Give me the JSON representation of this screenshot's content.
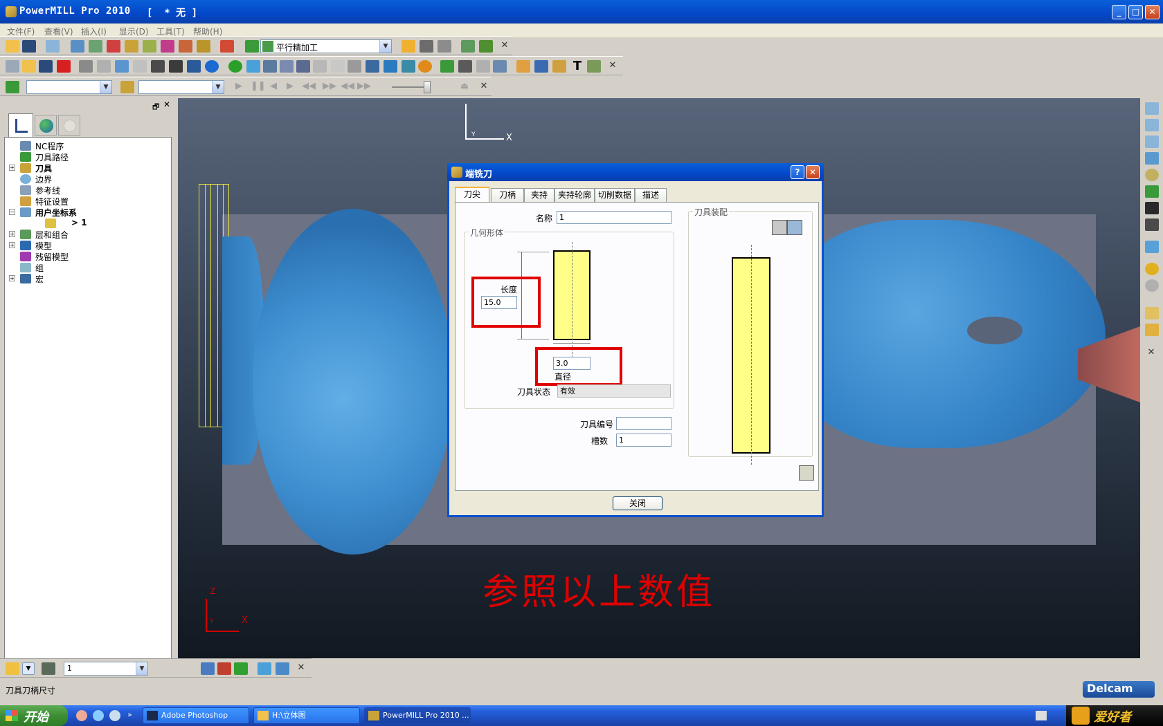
{
  "window": {
    "app_title": "PowerMILL Pro 2010",
    "doc_title": "[  * 无 ]",
    "min_label": "_",
    "max_label": "□",
    "close_label": "✕"
  },
  "menu": [
    "文件(F)",
    "查看(V)",
    "插入(I)",
    "显示(D)",
    "工具(T)",
    "帮助(H)"
  ],
  "toolbar1": {
    "strategy_combo": "平行精加工"
  },
  "toolbar3": {
    "combo1": "",
    "combo2": ""
  },
  "tree": {
    "items": [
      {
        "label": "NC程序",
        "bold": false,
        "expand": false
      },
      {
        "label": "刀具路径",
        "bold": false,
        "expand": false
      },
      {
        "label": "刀具",
        "bold": true,
        "expand": true
      },
      {
        "label": "边界",
        "bold": false,
        "expand": false
      },
      {
        "label": "参考线",
        "bold": false,
        "expand": false
      },
      {
        "label": "特征设置",
        "bold": false,
        "expand": false
      },
      {
        "label": "用户坐标系",
        "bold": true,
        "expand": true
      },
      {
        "label": "> 1",
        "bold": false,
        "expand": false
      },
      {
        "label": "层和组合",
        "bold": false,
        "expand": true
      },
      {
        "label": "模型",
        "bold": false,
        "expand": true
      },
      {
        "label": "残留模型",
        "bold": false,
        "expand": false
      },
      {
        "label": "组",
        "bold": false,
        "expand": false
      },
      {
        "label": "宏",
        "bold": false,
        "expand": true
      }
    ]
  },
  "viewport": {
    "top_axis_x": "X",
    "top_axis_y": "Y",
    "bottom_axis_z": "Z",
    "bottom_axis_x": "X",
    "bottom_axis_y": "Y",
    "annotation": "参照以上数值"
  },
  "dialog": {
    "title": "端铣刀",
    "help": "?",
    "close_x": "✕",
    "tabs": [
      "刀尖",
      "刀柄",
      "夹持",
      "夹持轮廓",
      "切削数据",
      "描述"
    ],
    "name_label": "名称",
    "name_value": "1",
    "geometry_group": "几何形体",
    "length_label": "长度",
    "length_value": "15.0",
    "diameter_value": "3.0",
    "diameter_label": "直径",
    "status_label": "刀具状态",
    "status_value": "有效",
    "tool_number_label": "刀具编号",
    "tool_number_value": "",
    "flutes_label": "槽数",
    "flutes_value": "1",
    "assembly_group": "刀具装配",
    "close_button": "关闭"
  },
  "bottom_toolbar": {
    "combo": "1"
  },
  "status": {
    "text": "刀具刀柄尺寸",
    "brand": "Delcam"
  },
  "taskbar": {
    "start": "开始",
    "tasks": [
      "Adobe Photoshop",
      "H:\\立体图",
      "PowerMILL Pro 2010 ..."
    ],
    "tray_logo": "爱好者"
  },
  "colors": {
    "title_blue": "#0a50d0",
    "model_blue": "#3f8fd0",
    "tool_yellow": "#ffff88",
    "highlight_red": "#e00000"
  }
}
